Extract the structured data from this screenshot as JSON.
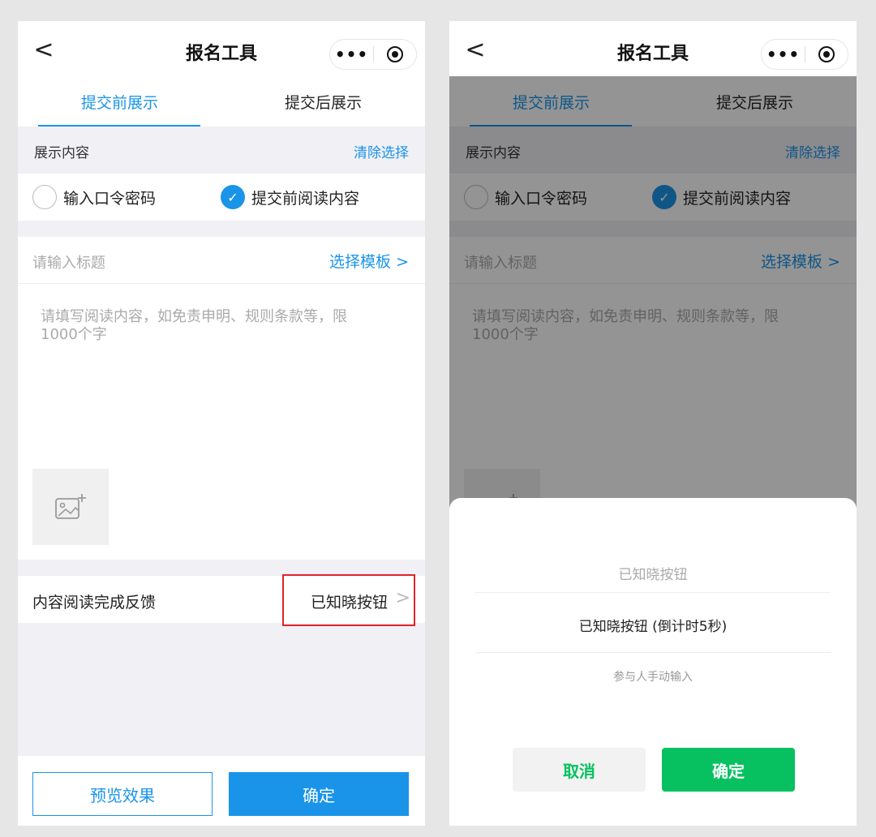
{
  "colors": {
    "accent": "#1a94e8",
    "highlight": "#e0232b",
    "wechat_green": "#07c160"
  },
  "navbar": {
    "back": "<",
    "title": "报名工具",
    "more": "•••"
  },
  "tabs": [
    {
      "label": "提交前展示"
    },
    {
      "label": "提交后展示"
    }
  ],
  "section": {
    "label": "展示内容",
    "clear": "清除选择"
  },
  "options": [
    {
      "label": "输入口令密码",
      "checked": false
    },
    {
      "label": "提交前阅读内容",
      "checked": true
    }
  ],
  "title_input": {
    "placeholder": "请输入标题",
    "template": "选择模板 >"
  },
  "content_input": {
    "placeholder": "请填写阅读内容，如免责申明、规则条款等，限1000个字"
  },
  "feedback": {
    "label": "内容阅读完成反馈",
    "value": "已知晓按钮",
    "chevron": ">"
  },
  "bottom": {
    "preview": "预览效果",
    "confirm": "确定"
  },
  "sheet": {
    "title": "已知晓按钮",
    "option1": "已知晓按钮 (倒计时5秒)",
    "option2": "参与人手动输入",
    "cancel": "取消",
    "ok": "确定"
  }
}
